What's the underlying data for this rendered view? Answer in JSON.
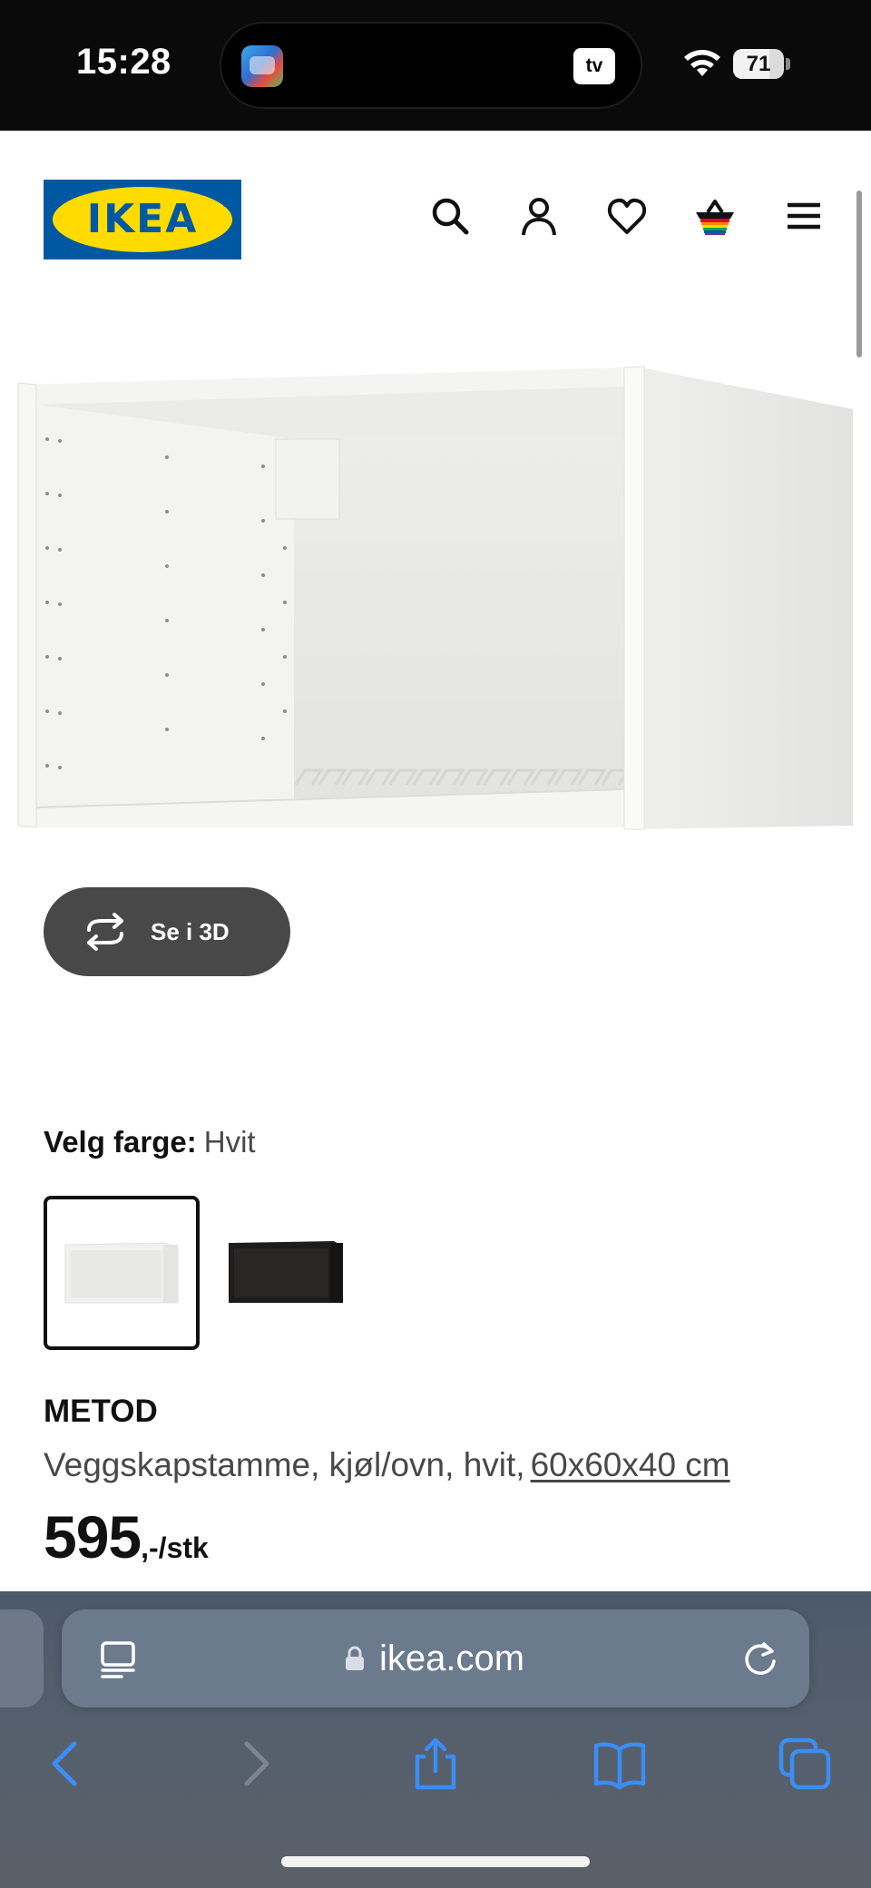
{
  "status_bar": {
    "time": "15:28",
    "battery_percent": 71,
    "battery_label": "71",
    "island_app_icon": "game-app-icon",
    "island_tv_label": "tv"
  },
  "header": {
    "logo_text": "IKEA",
    "logo_registered": "®",
    "icons": [
      "search-icon",
      "account-icon",
      "heart-icon",
      "basket-icon",
      "menu-icon"
    ]
  },
  "product": {
    "view_3d_label": "Se i 3D",
    "color_label": "Velg farge:",
    "color_value": "Hvit",
    "swatches": [
      "Hvit",
      "Svart"
    ],
    "name": "METOD",
    "description": "Veggskapstamme, kjøl/ovn, hvit,",
    "measurement": "60x60x40 cm",
    "price_integer": "595",
    "price_suffix": ",-/stk"
  },
  "browser": {
    "url": "ikea.com",
    "toolbar": [
      "back-icon",
      "forward-icon",
      "share-icon",
      "bookmarks-icon",
      "tabs-icon"
    ]
  },
  "colors": {
    "ikea_blue": "#0058a3",
    "ikea_yellow": "#ffdb00",
    "safari_blue": "#3a8ef6"
  }
}
